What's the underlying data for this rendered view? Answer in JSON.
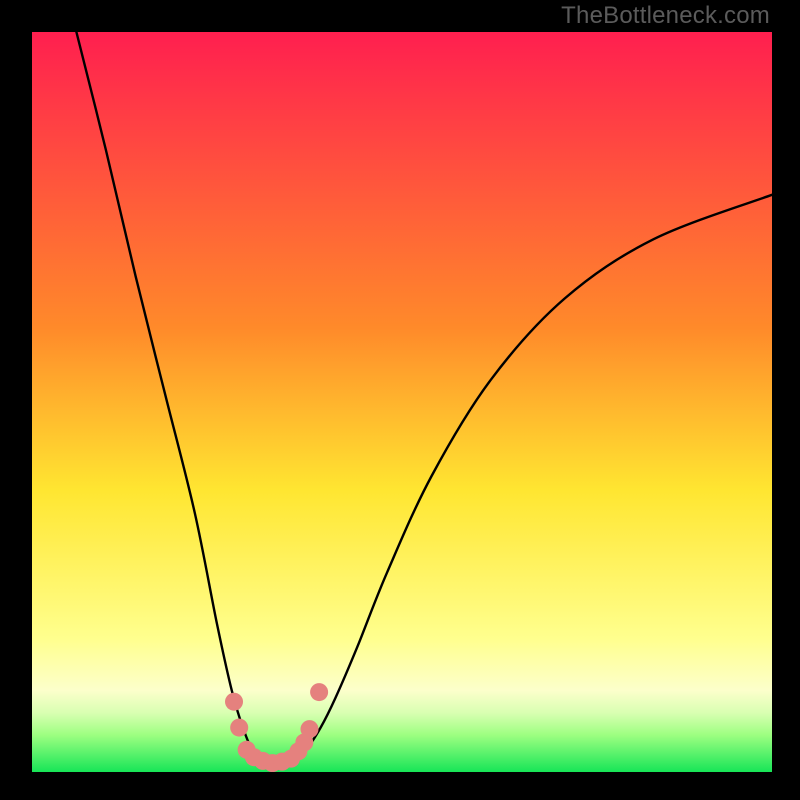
{
  "watermark": "TheBottleneck.com",
  "chart_data": {
    "type": "line",
    "title": "",
    "xlabel": "",
    "ylabel": "",
    "xlim": [
      0,
      100
    ],
    "ylim": [
      0,
      100
    ],
    "grid": false,
    "background_gradient": [
      {
        "stop": 0.0,
        "color": "#ff1f4f"
      },
      {
        "stop": 0.4,
        "color": "#ff8a2a"
      },
      {
        "stop": 0.62,
        "color": "#ffe631"
      },
      {
        "stop": 0.82,
        "color": "#ffff8e"
      },
      {
        "stop": 0.89,
        "color": "#fcffcb"
      },
      {
        "stop": 0.92,
        "color": "#d9ffb2"
      },
      {
        "stop": 0.95,
        "color": "#9dff81"
      },
      {
        "stop": 1.0,
        "color": "#17e557"
      }
    ],
    "green_band": {
      "y_top_fraction": 0.95,
      "y_bottom_fraction": 1.0
    },
    "series": [
      {
        "name": "bottleneck-curve",
        "x": [
          6,
          10,
          14,
          18,
          22,
          25,
          27,
          28.5,
          30,
          31.5,
          33,
          35,
          37,
          39,
          41,
          44,
          48,
          54,
          62,
          72,
          84,
          100
        ],
        "values": [
          100,
          84,
          67,
          51,
          35,
          20,
          11,
          6,
          2.5,
          1.5,
          1.2,
          1.5,
          3,
          6,
          10,
          17,
          27,
          40,
          53,
          64,
          72,
          78
        ]
      }
    ],
    "markers": {
      "name": "highlight-points",
      "x": [
        27.3,
        28.0,
        29.0,
        30.0,
        31.2,
        32.5,
        33.8,
        35.0,
        36.0,
        36.8,
        37.5,
        38.8
      ],
      "values": [
        9.5,
        6.0,
        3.0,
        2.0,
        1.5,
        1.2,
        1.4,
        1.8,
        2.8,
        4.0,
        5.8,
        10.8
      ]
    }
  }
}
